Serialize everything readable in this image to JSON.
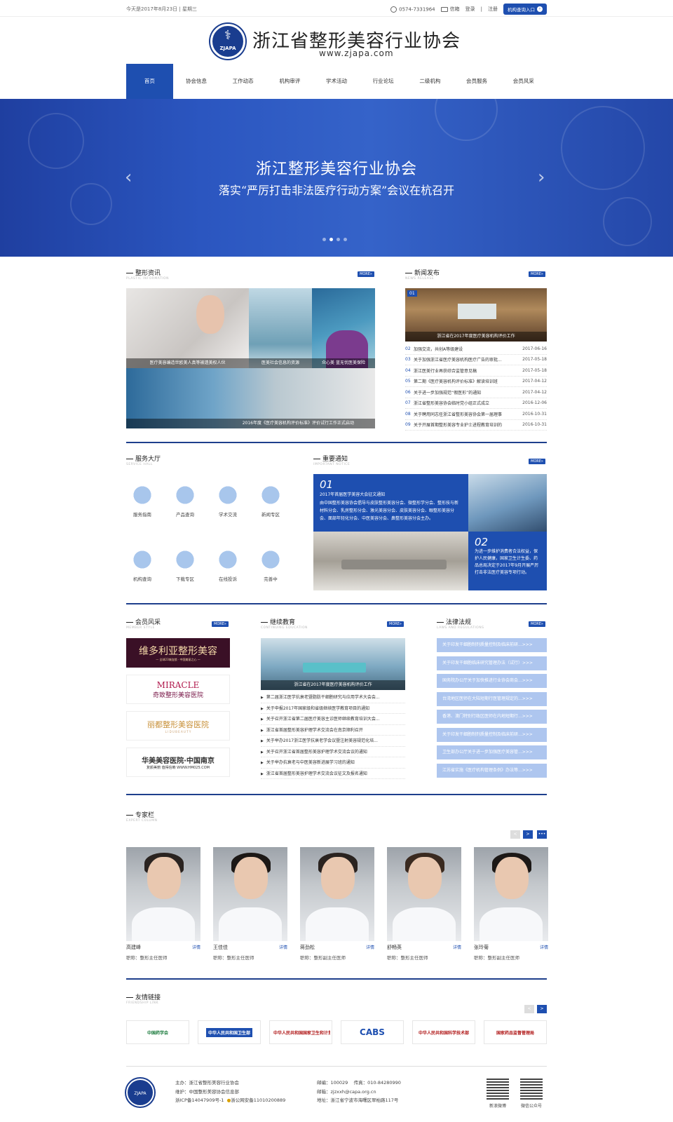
{
  "topbar": {
    "date": "今天是2017年8月23日 | 星期三",
    "phone": "0574-7331964",
    "mail": "信箱",
    "login": "登录",
    "sep": "|",
    "register": "注册",
    "query_btn": "机构查询入口"
  },
  "header": {
    "title": "浙江省整形美容行业协会",
    "url": "www.zjapa.com",
    "logo_abbr": "ZJAPA"
  },
  "nav": [
    "首页",
    "协会信息",
    "工作动态",
    "机构审评",
    "学术活动",
    "行业论坛",
    "二级机构",
    "会员服务",
    "会员风采"
  ],
  "banner": {
    "title": "浙江整形美容行业协会",
    "subtitle": "落实“严厉打击非法医疗行动方案”会议在杭召开",
    "prev": "‹",
    "next": "›"
  },
  "plastic": {
    "title": "整形资讯",
    "en": "PLASTIC INFORMATION",
    "more": "MORE»",
    "captions": [
      "医疗美容编造世欧美人真等被遗美权人伙",
      "医美社会信息的资源",
      "众心美 蓝无忧医美保险",
      "2016年度《医疗美容机构评价标准》评价试行工作正式启动"
    ]
  },
  "news": {
    "title": "新闻发布",
    "en": "NEWS RELEASE",
    "more": "MORE»",
    "badge": "01",
    "img_caption": "浙江省在2017年度医疗美容机构评价工作",
    "items": [
      {
        "n": "02",
        "t": "加强交流，共创A等级建设",
        "d": ""
      },
      {
        "n": "03",
        "t": "关于加强浙江省医疗美容机构医疗广告的审批...",
        "d": "2017-05-18"
      },
      {
        "n": "04",
        "t": "浙江医美行业再获综合监管意见稿",
        "d": "2017-05-18"
      },
      {
        "n": "05",
        "t": "第二期《医疗美容机构评价标准》解读培训班",
        "d": "2017-04-12"
      },
      {
        "n": "06",
        "t": "关于进一步加强规范“假医形”的通知",
        "d": "2017-04-12"
      },
      {
        "n": "07",
        "t": "浙江省整形美容协会临时党小组正式成立",
        "d": "2016-12-06"
      },
      {
        "n": "08",
        "t": "关于聘用同志任浙江省整形美容协会第一届理事",
        "d": "2016-10-31"
      },
      {
        "n": "09",
        "t": "关于开展首期整形美容专业护士进程教育培训的",
        "d": "2016-10-31"
      }
    ],
    "first_date": "2017-06-16"
  },
  "service": {
    "title": "服务大厅",
    "en": "SERVICE HALL",
    "items": [
      "服务指南",
      "产品查询",
      "学术交流",
      "新闻专区",
      "机构查询",
      "下载专区",
      "在线投诉",
      "完善中"
    ]
  },
  "notice": {
    "title": "重要通知",
    "en": "IMPORTANT NOTICE",
    "more": "MORE»",
    "n1": "01",
    "t1": "2017年首届医学美容大会征文通知",
    "b1": "由中国整形美容协会倡导与皮肤整形美容分会、微整形学分会、整形技与新材料分会、乳房整形分会、激光美容分会、皮肤美容分会、眼整形美容分会、面部年轻化分会、中医美容分会、鼻整形美容分会主办。",
    "n2": "02",
    "b2": "为进一步维护消费者合法权益，保护人民健康，国家卫生计生委、药品总局决定于2017年9月开展严厉打击非法医疗美容专项行动。"
  },
  "member": {
    "title": "会员风采",
    "en": "MEMBER STYLE",
    "more": "MORE»",
    "logos": [
      "维多利亚整形美容",
      "奇致整形美容医院",
      "丽都整形美容医院",
      "华美美容医院·中国南京"
    ],
    "miracle": "MIRACLE",
    "vic_sub": "— 全球23城连锁 · 中国美丽之心 —",
    "huamei_sub": "复颜美丽 值得信赖 WWW.HM025.COM",
    "lidu_sub": "L I D U   B E A U T Y"
  },
  "edu": {
    "title": "继续教育",
    "en": "CONTINUING EDUCATION",
    "more": "MORE»",
    "img_caption": "浙江省在2017年度医疗美容机构评价工作",
    "items": [
      "第二届浙江医学抗衰老暨脂肪干细胞研究与应用学术大会会...",
      "关于申报2017年国家级和省级继续医学教育项目的通知",
      "关于召开浙江省第二届医疗美容主诊医师继续教育培训大会...",
      "浙江省首届整形美容护理学术交流会在南京顺利召开",
      "关于举办2017浙江医学抗衰老学会议暨注射美容规范化培...",
      "关于召开浙江省首届整形美容护理学术交流会议的通知",
      "关于举办抗衰老与中医美容新进展学习班的通知",
      "浙江省首届整形美容护理学术交流会议征文及报名通知"
    ]
  },
  "laws": {
    "title": "法律法规",
    "en": "LAWS AND REGULATIONS",
    "more": "MORE»",
    "items": [
      "关于印发干细胞制剂质量控制及临床前研...>>>",
      "关于印发干细胞临床研究管理办法（试行）>>>",
      "国务院办公厅关于加快推进行业协会商会...>>>",
      "台湾地区医师在大陆短期行医管理规定的...>>>",
      "香港、澳门特别行政区医师在内地短期行...>>>",
      "关于印发干细胞制剂质量控制及临床前研...>>>",
      "卫生部办公厅关于进一步加强医疗美容管...>>>",
      "江苏省实施《医疗机构管理条例》办法等...>>>"
    ]
  },
  "experts": {
    "title": "专家栏",
    "en": "EXPERT COLUMN",
    "detail": "详情",
    "items": [
      {
        "name": "高建峰",
        "pos": "职称：整形主任医师"
      },
      {
        "name": "王佳佳",
        "pos": "职称：整形主任医师"
      },
      {
        "name": "蒋劲松",
        "pos": "职称：整形副主任医师"
      },
      {
        "name": "舒畅英",
        "pos": "职称：整形主任医师"
      },
      {
        "name": "张玲菊",
        "pos": "职称：整形副主任医师"
      }
    ],
    "prev": "<",
    "next": ">",
    "all": "•••"
  },
  "links": {
    "title": "友情链接",
    "en": "FRIENDSHIP LINK",
    "prev": "<",
    "next": ">",
    "items": [
      "中国药学会",
      "中华人民共和国卫生部",
      "中华人民共和国国家卫生和计划生育委员会",
      "CABS",
      "中华人民共和国科学技术部",
      "国家药品监督管理局"
    ]
  },
  "footer": {
    "host": "主办：浙江省整形美容行业协会",
    "tech": "维护：中国整形美容协会信息部",
    "icp": "浙ICP备14047909号-1",
    "police": "浙公网安备11010200889",
    "post": "邮编：100029",
    "fax": "传真：010-84280990",
    "email": "邮箱：zjzxxh@capa.org.cn",
    "addr": "地址：浙江省宁波市海曙区翠柏路117号",
    "qr1": "新浪微博",
    "qr2": "微信公众号"
  },
  "colors": {
    "primary": "#1e4fb0",
    "law_bg": "#aec6ef",
    "dark_line": "#1e3f8c"
  }
}
